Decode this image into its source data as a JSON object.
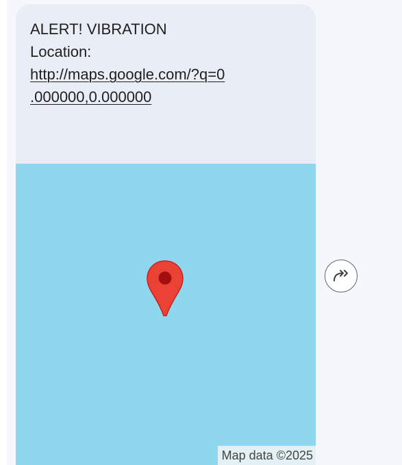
{
  "message": {
    "alert_line": "ALERT! VIBRATION",
    "location_label": "Location:",
    "link_line_1": "http://maps.google.com/?q=0",
    "link_line_2": ".000000,0.000000"
  },
  "map": {
    "attribution": "Map data ©2025",
    "water_color": "#8fd7ee",
    "pin_icon": "map-pin-icon",
    "pin_color": "#ea4335"
  },
  "actions": {
    "forward_icon": "forward-icon"
  },
  "colors": {
    "bubble": "#e9edf6",
    "background": "#f5f7fc"
  }
}
